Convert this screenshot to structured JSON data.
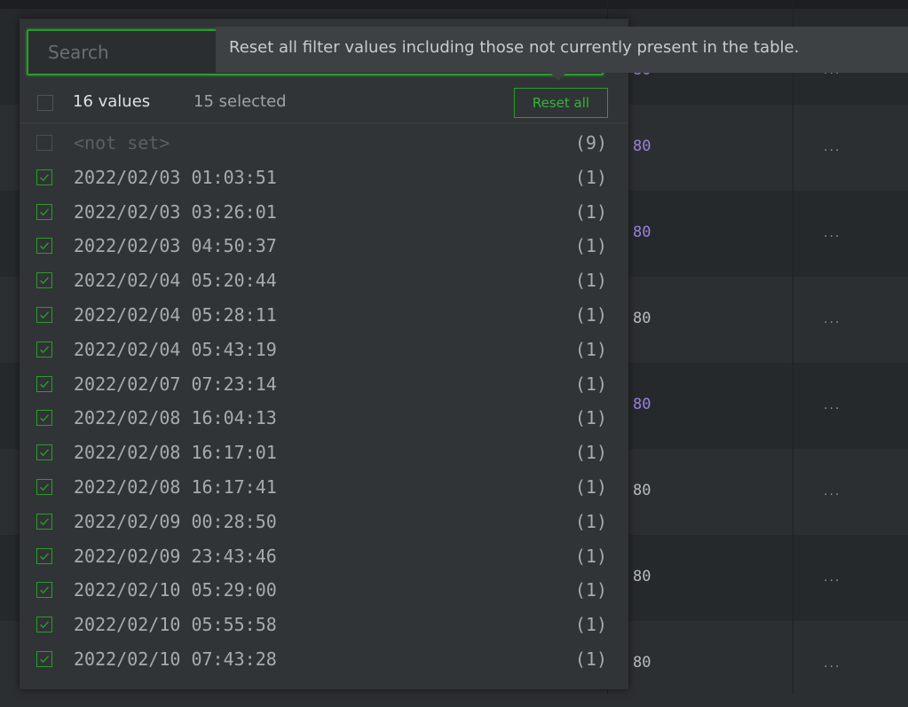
{
  "colors": {
    "accent_green": "#2c9b2c",
    "value_purple": "#9a81dc",
    "background": "#26292b",
    "panel": "#303436"
  },
  "table": {
    "rows": [
      {
        "value": "80",
        "more": "...",
        "style": "purple"
      },
      {
        "value": "80",
        "more": "...",
        "style": "purple"
      },
      {
        "value": "80",
        "more": "...",
        "style": "purple"
      },
      {
        "value": "80",
        "more": "...",
        "style": "plain"
      },
      {
        "value": "80",
        "more": "...",
        "style": "purple"
      },
      {
        "value": "80",
        "more": "...",
        "style": "plain"
      },
      {
        "value": "80",
        "more": "...",
        "style": "plain"
      },
      {
        "value": "80",
        "more": "...",
        "style": "plain"
      }
    ]
  },
  "filter": {
    "search_placeholder": "Search",
    "values_count": "16 values",
    "selected_count": "15 selected",
    "reset_all_label": "Reset all",
    "items": [
      {
        "label": "<not set>",
        "count": "(9)",
        "checked": false
      },
      {
        "label": "2022/02/03 01:03:51",
        "count": "(1)",
        "checked": true
      },
      {
        "label": "2022/02/03 03:26:01",
        "count": "(1)",
        "checked": true
      },
      {
        "label": "2022/02/03 04:50:37",
        "count": "(1)",
        "checked": true
      },
      {
        "label": "2022/02/04 05:20:44",
        "count": "(1)",
        "checked": true
      },
      {
        "label": "2022/02/04 05:28:11",
        "count": "(1)",
        "checked": true
      },
      {
        "label": "2022/02/04 05:43:19",
        "count": "(1)",
        "checked": true
      },
      {
        "label": "2022/02/07 07:23:14",
        "count": "(1)",
        "checked": true
      },
      {
        "label": "2022/02/08 16:04:13",
        "count": "(1)",
        "checked": true
      },
      {
        "label": "2022/02/08 16:17:01",
        "count": "(1)",
        "checked": true
      },
      {
        "label": "2022/02/08 16:17:41",
        "count": "(1)",
        "checked": true
      },
      {
        "label": "2022/02/09 00:28:50",
        "count": "(1)",
        "checked": true
      },
      {
        "label": "2022/02/09 23:43:46",
        "count": "(1)",
        "checked": true
      },
      {
        "label": "2022/02/10 05:29:00",
        "count": "(1)",
        "checked": true
      },
      {
        "label": "2022/02/10 05:55:58",
        "count": "(1)",
        "checked": true
      },
      {
        "label": "2022/02/10 07:43:28",
        "count": "(1)",
        "checked": true
      }
    ]
  },
  "tooltip": {
    "text": "Reset all filter values including those not currently present in the table."
  }
}
